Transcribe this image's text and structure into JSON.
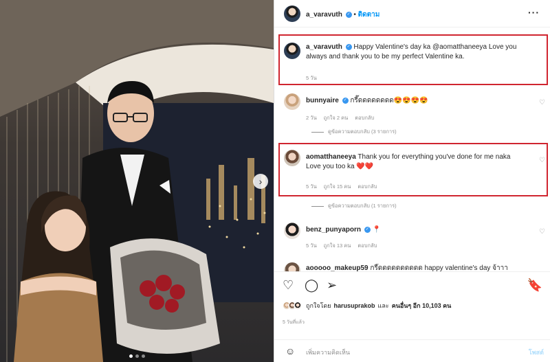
{
  "post": {
    "owner": "a_varavuth",
    "follow_label": "ติดตาม",
    "more_icon": "more-horizontal-icon",
    "caption": {
      "username": "a_varavuth",
      "text": "Happy Valentine's day ka @aomatthaneeya Love you always and thank you to be my perfect Valentine ka.",
      "time": "5 วัน"
    }
  },
  "comments": [
    {
      "username": "bunnyaire",
      "verified": true,
      "text": "กรี๊ดดดดดดดด😍😍😍😍",
      "time": "2 วัน",
      "likes": "ถูกใจ 2 คน",
      "reply_label": "ตอบกลับ",
      "replies_label": "ดูข้อความตอบกลับ (3 รายการ)"
    },
    {
      "username": "aomatthaneeya",
      "verified": false,
      "text": "Thank you for everything you've done for me naka Love you too ka ❤️❤️",
      "time": "5 วัน",
      "likes": "ถูกใจ 15 คน",
      "reply_label": "ตอบกลับ",
      "replies_label": "ดูข้อความตอบกลับ (1 รายการ)"
    },
    {
      "username": "benz_punyaporn",
      "verified": true,
      "text": "📍",
      "time": "5 วัน",
      "likes": "ถูกใจ 13 คน",
      "reply_label": "ตอบกลับ"
    },
    {
      "username": "aooooo_makeup59",
      "text": "กรี๊ดดดดดดดดดด happy valentine's day จ้าาา"
    }
  ],
  "likes": {
    "prefix": "ถูกใจโดย",
    "user": "harusuprakob",
    "conj": "และ",
    "others": "คนอื่นๆ อีก 10,103 คน"
  },
  "date": "5 วันที่แล้ว",
  "add_comment": {
    "placeholder": "เพิ่มความคิดเห็น",
    "post_label": "โพสต์"
  },
  "colors": {
    "accent": "#0095f6",
    "highlight": "#d0252f",
    "verified": "#3897f0"
  }
}
